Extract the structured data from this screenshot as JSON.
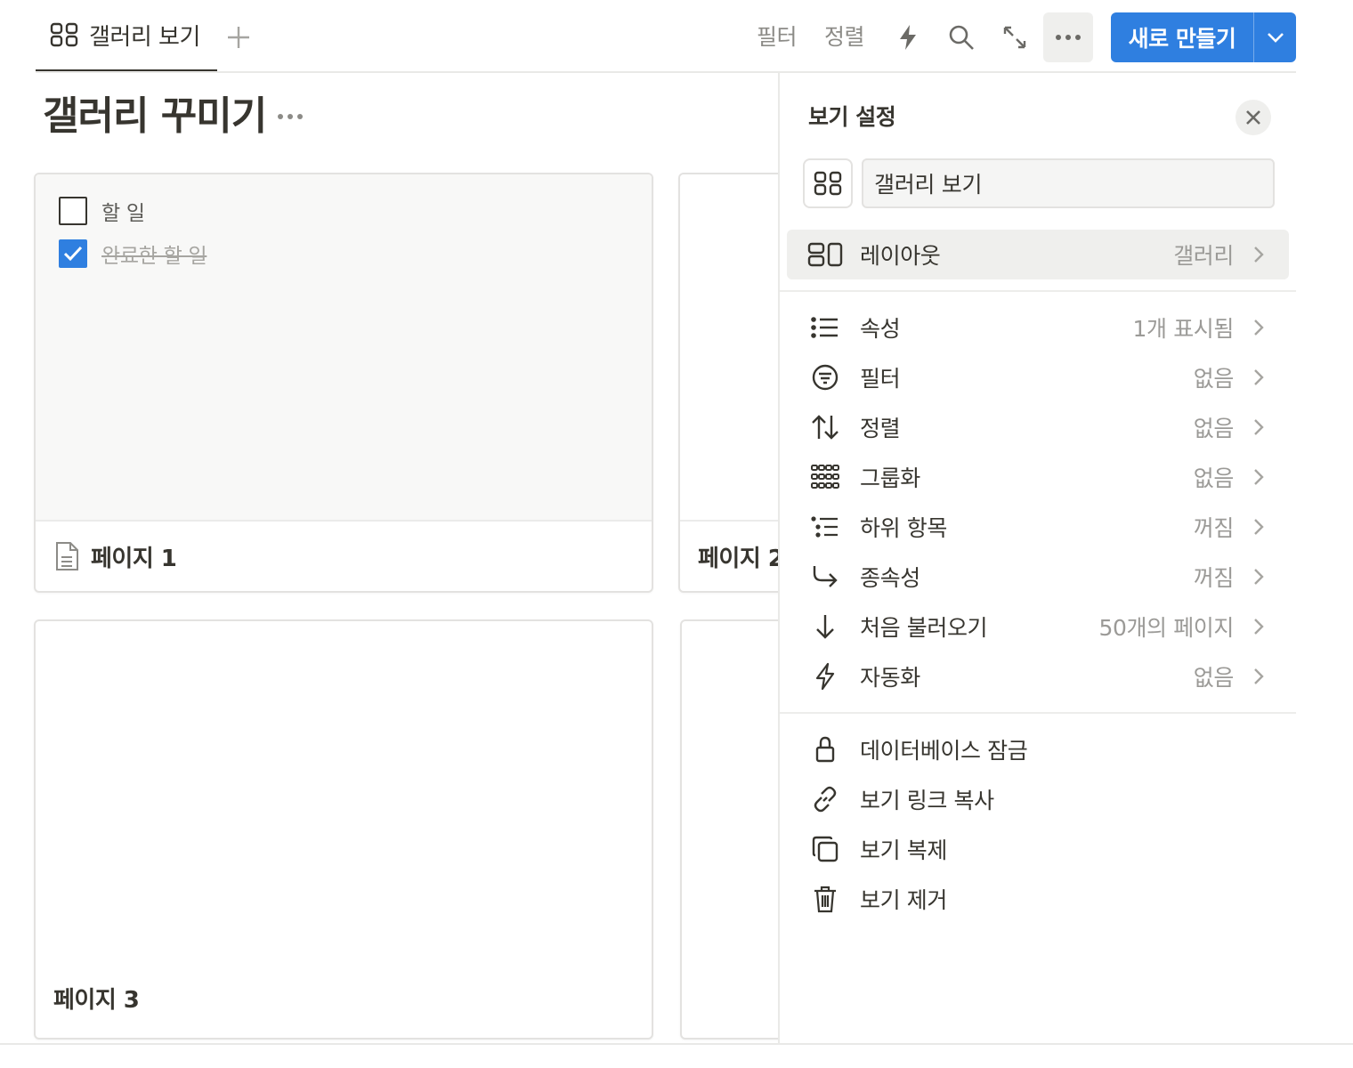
{
  "topbar": {
    "active_tab_label": "갤러리 보기",
    "filter_label": "필터",
    "sort_label": "정렬",
    "new_button_label": "새로 만들기"
  },
  "page": {
    "title": "갤러리 꾸미기"
  },
  "gallery": {
    "cards": [
      {
        "name": "페이지 1",
        "todos": [
          {
            "text": "할 일",
            "checked": false
          },
          {
            "text": "완료한 할 일",
            "checked": true
          }
        ]
      },
      {
        "name": "페이지 2"
      },
      {
        "name": "페이지 3"
      },
      {
        "name": ""
      }
    ]
  },
  "settings": {
    "title": "보기 설정",
    "view_name": "갤러리 보기",
    "layout": {
      "label": "레이아웃",
      "value": "갤러리"
    },
    "options": [
      {
        "label": "속성",
        "value": "1개 표시됨",
        "icon": "list-icon"
      },
      {
        "label": "필터",
        "value": "없음",
        "icon": "filter-icon"
      },
      {
        "label": "정렬",
        "value": "없음",
        "icon": "sort-icon"
      },
      {
        "label": "그룹화",
        "value": "없음",
        "icon": "group-icon"
      },
      {
        "label": "하위 항목",
        "value": "꺼짐",
        "icon": "sub-items-icon"
      },
      {
        "label": "종속성",
        "value": "꺼짐",
        "icon": "dependency-icon"
      },
      {
        "label": "처음 불러오기",
        "value": "50개의 페이지",
        "icon": "arrow-down-icon"
      },
      {
        "label": "자동화",
        "value": "없음",
        "icon": "lightning-icon"
      }
    ],
    "actions": [
      {
        "label": "데이터베이스 잠금",
        "icon": "lock-icon"
      },
      {
        "label": "보기 링크 복사",
        "icon": "link-icon"
      },
      {
        "label": "보기 복제",
        "icon": "duplicate-icon"
      },
      {
        "label": "보기 제거",
        "icon": "trash-icon"
      }
    ]
  },
  "colors": {
    "accent": "#2f7fe0",
    "text": "#37352f",
    "muted": "#9b9a97",
    "hover": "#efefed"
  }
}
